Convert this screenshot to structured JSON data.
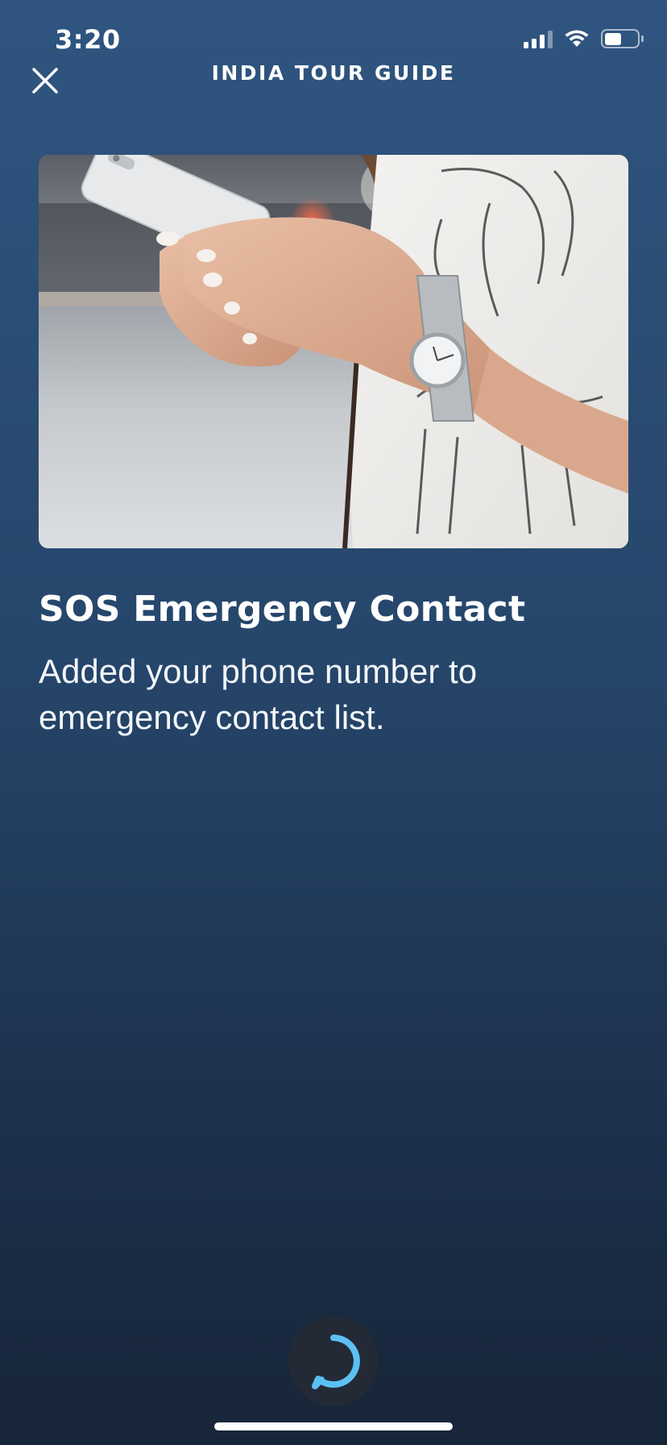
{
  "status_bar": {
    "time": "3:20",
    "icons": [
      "signal-icon",
      "wifi-icon",
      "battery-icon"
    ]
  },
  "header": {
    "title": "INDIA TOUR GUIDE",
    "close_icon": "close-icon"
  },
  "hero": {
    "image": "woman-using-phone-photo"
  },
  "content": {
    "title": "SOS Emergency Contact",
    "body": "Added your phone number to emergency contact list."
  },
  "footer": {
    "alexa_icon": "alexa-ring-icon"
  },
  "colors": {
    "background_top": "#2f5580",
    "background_bottom": "#172538",
    "alexa_ring": "#5bc0f4",
    "alexa_button_bg": "#232a36",
    "text": "#ffffff"
  }
}
